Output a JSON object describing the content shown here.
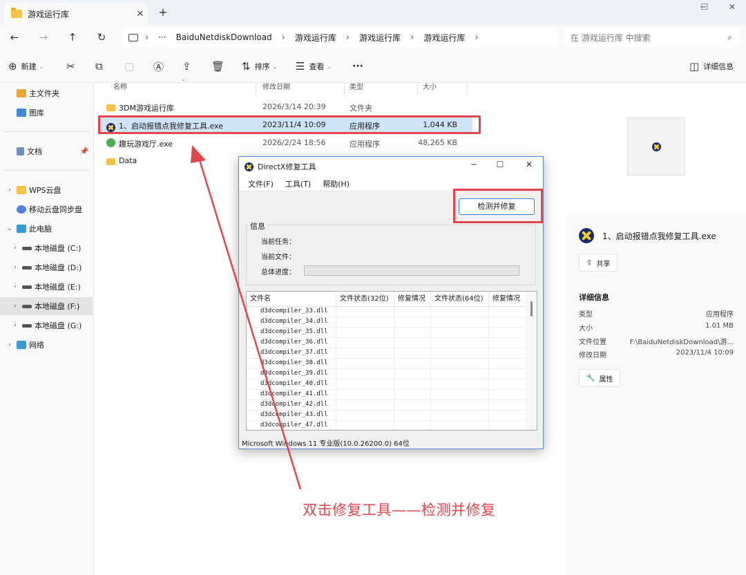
{
  "window": {
    "tab_title": "游戏运行库",
    "tab_close": "✕",
    "new_tab": "+",
    "minimize": "─",
    "maximize": "☐",
    "close": "✕"
  },
  "nav": {
    "back": "←",
    "forward": "→",
    "up": "↑",
    "refresh": "↻",
    "path": [
      "BaiduNetdiskDownload",
      "游戏运行库",
      "游戏运行库",
      "游戏运行库"
    ],
    "ellipsis": "···",
    "chevron": "›",
    "search_placeholder": "在 游戏运行库 中搜索"
  },
  "toolbar": {
    "new_label": "新建",
    "sort_label": "排序",
    "view_label": "查看",
    "more": "···",
    "details_label": "详细信息"
  },
  "sidebar": {
    "items": [
      {
        "label": "主文件夹",
        "icon": "home-icon"
      },
      {
        "label": "图库",
        "icon": "gallery-icon"
      },
      {
        "label": "文档",
        "icon": "document-icon"
      },
      {
        "label": "WPS云盘",
        "icon": "folder-icon"
      },
      {
        "label": "移动云盘同步盘",
        "icon": "cloud-icon"
      },
      {
        "label": "此电脑",
        "icon": "pc-icon"
      },
      {
        "label": "本地磁盘 (C:)",
        "icon": "drive-icon"
      },
      {
        "label": "本地磁盘 (D:)",
        "icon": "drive-icon"
      },
      {
        "label": "本地磁盘 (E:)",
        "icon": "drive-icon"
      },
      {
        "label": "本地磁盘 (F:)",
        "icon": "drive-icon"
      },
      {
        "label": "本地磁盘 (G:)",
        "icon": "drive-icon"
      },
      {
        "label": "网络",
        "icon": "network-icon"
      }
    ]
  },
  "list": {
    "headers": {
      "name": "名称",
      "modified": "修改日期",
      "type": "类型",
      "size": "大小"
    },
    "rows": [
      {
        "name": "3DM游戏运行库",
        "modified": "2026/3/14 20:39",
        "type": "文件夹",
        "size": ""
      },
      {
        "name": "1、启动报错点我修复工具.exe",
        "modified": "2023/11/4 10:09",
        "type": "应用程序",
        "size": "1,044 KB"
      },
      {
        "name": "趣玩游戏厅.exe",
        "modified": "2026/2/24 18:56",
        "type": "应用程序",
        "size": "48,265 KB"
      },
      {
        "name": "Data",
        "modified": "",
        "type": "",
        "size": ""
      }
    ]
  },
  "details_pane": {
    "file_title": "1、启动报错点我修复工具.exe",
    "share_label": "共享",
    "heading": "详细信息",
    "fields": [
      {
        "label": "类型",
        "value": "应用程序"
      },
      {
        "label": "大小",
        "value": "1.01 MB"
      },
      {
        "label": "文件位置",
        "value": "F:\\BaiduNetdiskDownload\\游..."
      },
      {
        "label": "修改日期",
        "value": "2023/11/4 10:09"
      }
    ],
    "properties_label": "属性"
  },
  "dialog": {
    "title": "DirectX修复工具",
    "menus": [
      "文件(F)",
      "工具(T)",
      "帮助(H)"
    ],
    "detect_button": "检测并修复",
    "group_label": "信息",
    "current_task_label": "当前任务：",
    "current_file_label": "当前文件：",
    "overall_progress_label": "总体进度：",
    "progress": 0,
    "table_headers": [
      "文件名",
      "文件状态(32位)",
      "修复情况",
      "文件状态(64位)",
      "修复情况"
    ],
    "files": [
      "d3dcompiler_33.dll",
      "d3dcompiler_34.dll",
      "d3dcompiler_35.dll",
      "d3dcompiler_36.dll",
      "d3dcompiler_37.dll",
      "d3dcompiler_38.dll",
      "d3dcompiler_39.dll",
      "d3dcompiler_40.dll",
      "d3dcompiler_41.dll",
      "d3dcompiler_42.dll",
      "d3dcompiler_43.dll",
      "d3dcompiler_47.dll"
    ],
    "status_text": "Microsoft Windows 11 专业版(10.0.26200.0) 64位"
  },
  "annotation": {
    "text": "双击修复工具——检测并修复",
    "color": "#e5454a"
  }
}
